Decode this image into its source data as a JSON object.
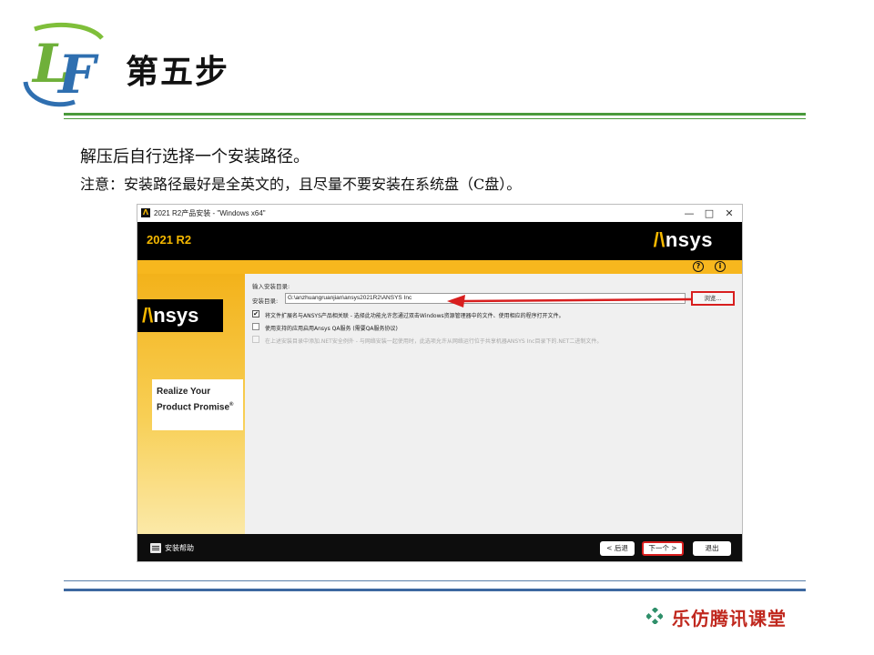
{
  "slide": {
    "title": "第五步",
    "instruction_1": "解压后自行选择一个安装路径。",
    "instruction_2": "注意：安装路径最好是全英文的，且尽量不要安装在系统盘（C盘）。",
    "footer_brand": "乐仿腾讯课堂",
    "colors": {
      "green_rule": "#4a9a3c",
      "blue_rule": "#3d68a0",
      "brand_red": "#c0281e"
    }
  },
  "window": {
    "title": "2021 R2产品安装 - \"Windows x64\"",
    "controls": {
      "minimize": "—",
      "maximize": "□",
      "close": "✕"
    },
    "banner": {
      "version": "2021 R2",
      "brand_mark": "/\\",
      "brand_text": "nsys"
    },
    "side": {
      "logo_mark": "/\\",
      "logo_text": "nsys",
      "tagline_1": "Realize Your",
      "tagline_2": "Product Promise",
      "reg": "®"
    },
    "help_icons": [
      "?",
      "i"
    ],
    "form": {
      "section_label": "输入安装目录:",
      "dir_label": "安装目录:",
      "dir_value": "G:\\anzhuangruanjian\\ansys2021R2\\ANSYS Inc",
      "browse_label": "浏览...",
      "options": [
        {
          "label": "将文件扩展名与ANSYS产品相关联 - 选择此功能允许您通过双击Windows资源管理器中的文件、使用相应的程序打开文件。",
          "checked": true,
          "disabled": false
        },
        {
          "label": "使用支持的应用启用Ansys QA服务 (需要QA服务协议)",
          "checked": false,
          "disabled": false
        },
        {
          "label": "在上述安装目录中添加.NET安全例外 - 与网络安装一起使用时，此选项允许从网络运行位于共享机器ANSYS Inc目录下的.NET二进制文件。",
          "checked": false,
          "disabled": true
        }
      ]
    },
    "footer": {
      "help_label": "安装帮助",
      "back_label": "< 后退",
      "next_label": "下一个 >",
      "exit_label": "退出"
    },
    "colors": {
      "ansys_yellow": "#f7b71e",
      "highlight_red": "#d81e1e",
      "banner_black": "#000000"
    }
  }
}
